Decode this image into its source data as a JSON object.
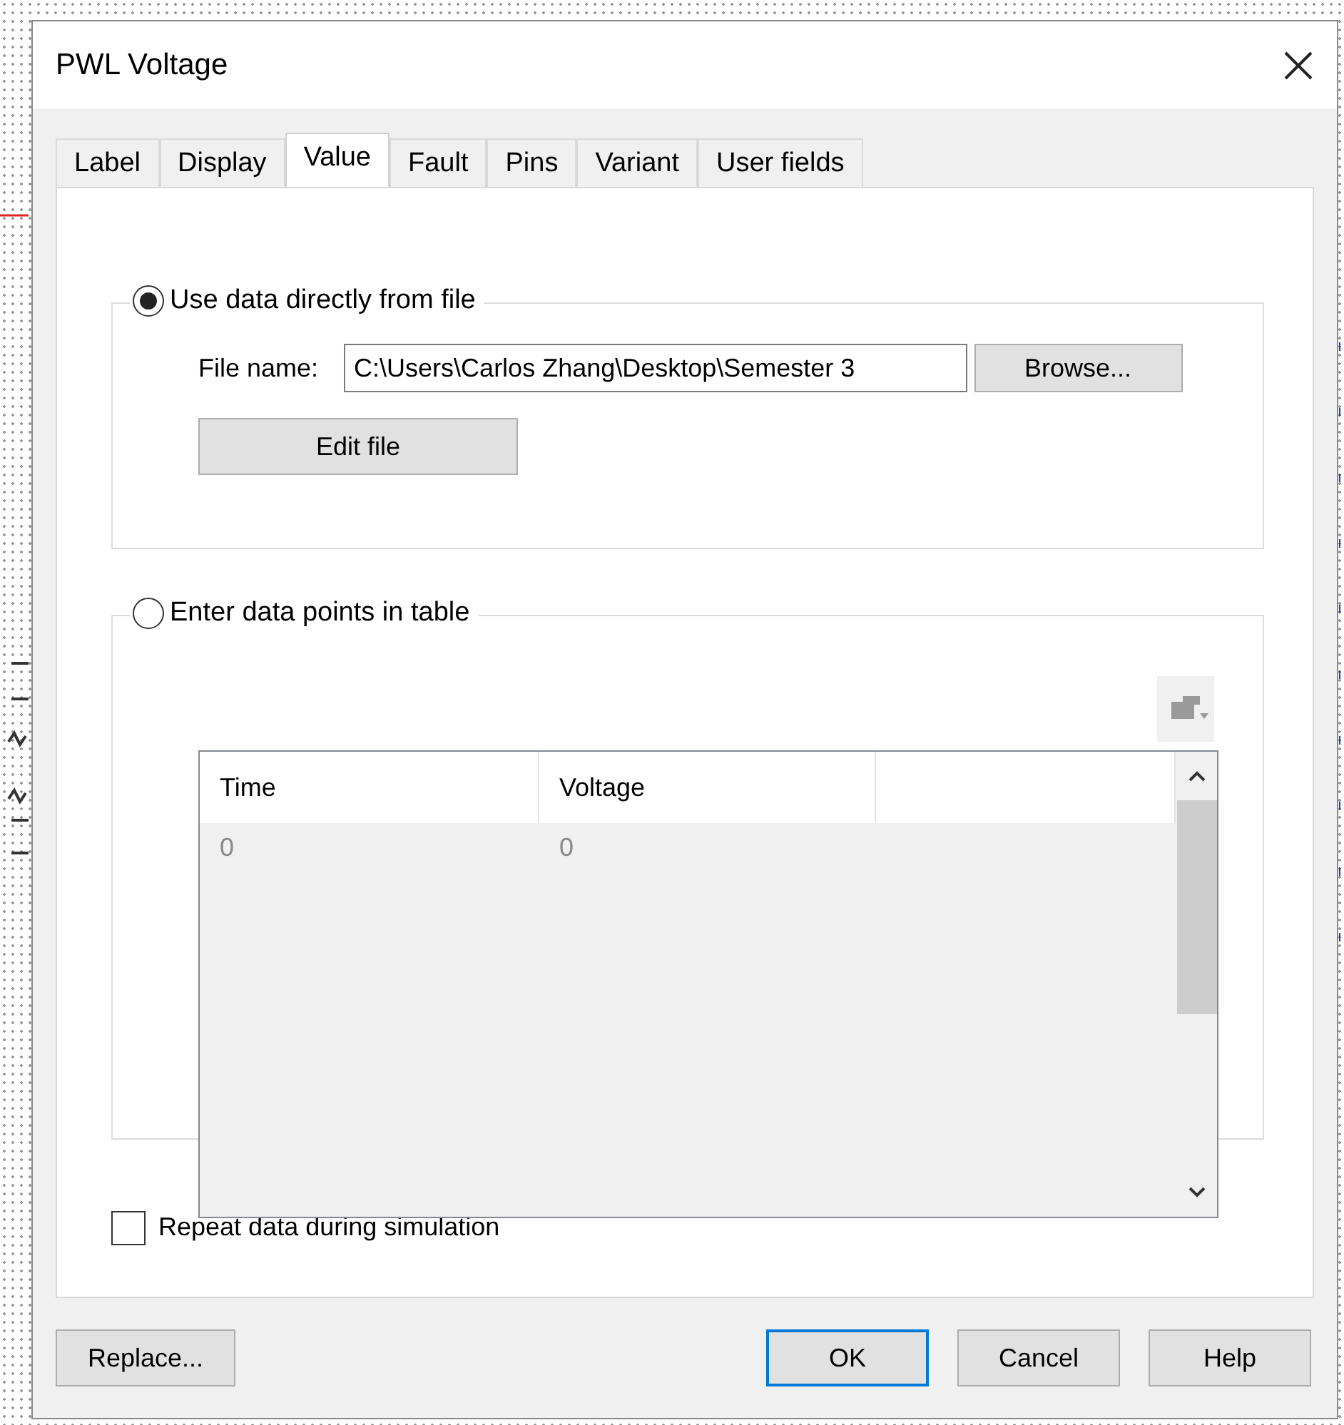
{
  "window": {
    "title": "PWL Voltage"
  },
  "tabs": [
    {
      "label": "Label",
      "selected": false
    },
    {
      "label": "Display",
      "selected": false
    },
    {
      "label": "Value",
      "selected": true
    },
    {
      "label": "Fault",
      "selected": false
    },
    {
      "label": "Pins",
      "selected": false
    },
    {
      "label": "Variant",
      "selected": false
    },
    {
      "label": "User fields",
      "selected": false
    }
  ],
  "source_options": [
    {
      "kind": "file",
      "label": "Use data directly from file",
      "selected": true,
      "file_name_label": "File name:",
      "file_name": "C:\\Users\\Carlos Zhang\\Desktop\\Semester 3",
      "browse_button": "Browse...",
      "edit_button": "Edit file"
    },
    {
      "kind": "table",
      "label": "Enter data points in table",
      "selected": false,
      "table": {
        "columns": [
          "Time",
          "Voltage"
        ],
        "rows": [
          [
            "0",
            "0"
          ]
        ]
      }
    }
  ],
  "repeat_checkbox": {
    "label": "Repeat data during simulation",
    "checked": false
  },
  "buttons": [
    {
      "label": "Replace...",
      "default": false
    },
    {
      "label": "OK",
      "default": true
    },
    {
      "label": "Cancel",
      "default": false
    },
    {
      "label": "Help",
      "default": false
    }
  ]
}
